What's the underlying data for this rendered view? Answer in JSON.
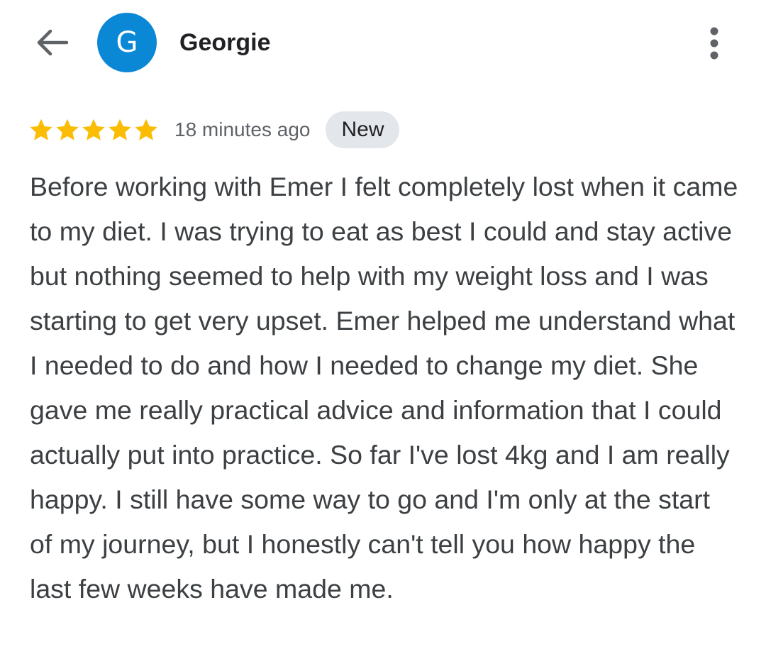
{
  "header": {
    "back_icon": "arrow-back-icon",
    "avatar_letter": "G",
    "avatar_color": "#0a88d6",
    "reviewer_name": "Georgie",
    "menu_icon": "more-vertical-icon"
  },
  "review": {
    "rating": 5,
    "rating_max": 5,
    "star_color": "#fbbc04",
    "time_ago": "18 minutes ago",
    "badge": "New",
    "text": "Before working with Emer I felt completely lost when it came to my diet. I was trying to eat as best I could and stay active but nothing seemed to help with my weight loss and I was starting to get very upset. Emer helped me understand what I needed to do and how I needed to change my diet. She gave me really practical advice and information that I could actually put into practice. So far I've lost 4kg and I am really happy. I still have some way to go and I'm only at the start of my journey, but I honestly can't tell you how happy the last few weeks have made me."
  }
}
